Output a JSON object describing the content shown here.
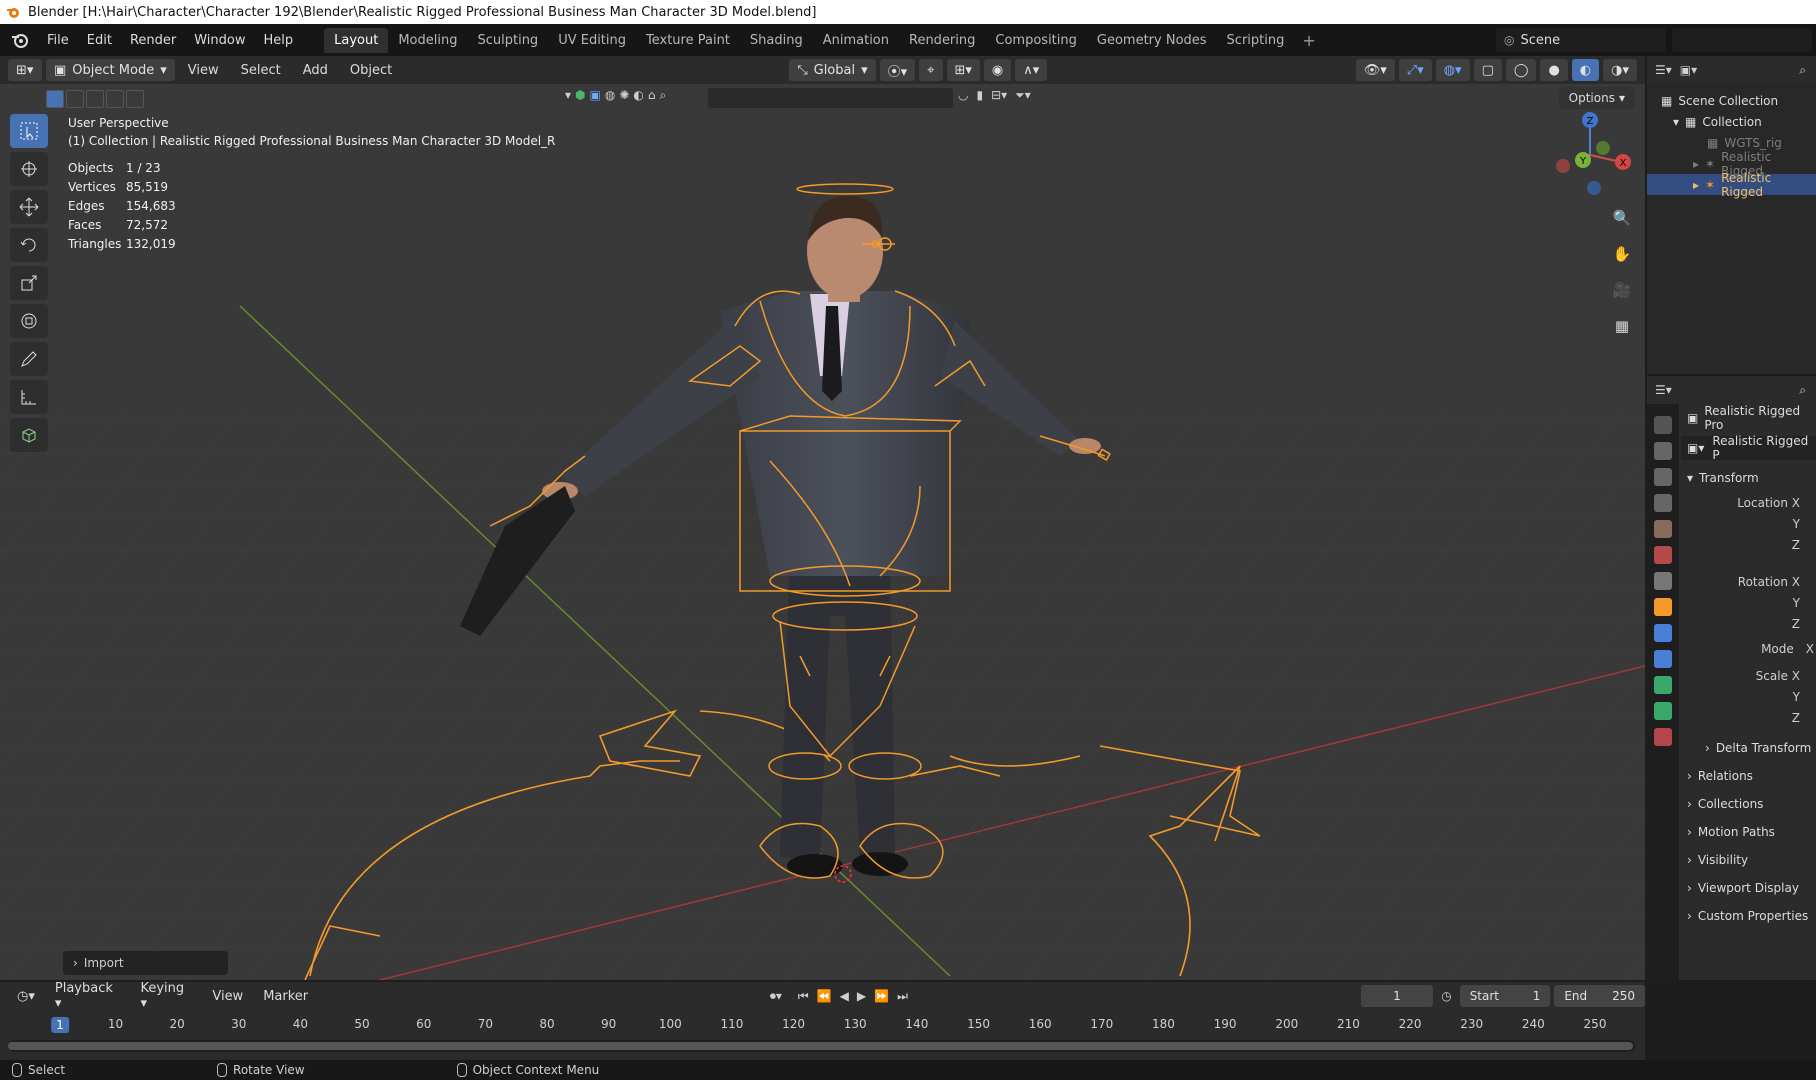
{
  "window": {
    "title": "Blender [H:\\Hair\\Character\\Character 192\\Blender\\Realistic Rigged Professional Business Man Character 3D Model.blend]"
  },
  "menu": {
    "items": [
      "File",
      "Edit",
      "Render",
      "Window",
      "Help"
    ]
  },
  "workspaces": {
    "items": [
      "Layout",
      "Modeling",
      "Sculpting",
      "UV Editing",
      "Texture Paint",
      "Shading",
      "Animation",
      "Rendering",
      "Compositing",
      "Geometry Nodes",
      "Scripting"
    ],
    "active": "Layout"
  },
  "scene": {
    "name": "Scene"
  },
  "viewport": {
    "mode": "Object Mode",
    "menus": [
      "View",
      "Select",
      "Add",
      "Object"
    ],
    "transform_orientation": "Global",
    "options_label": "Options",
    "perspective": "User Perspective",
    "collection_line": "(1) Collection | Realistic Rigged Professional Business Man Character 3D Model_R",
    "stats": [
      {
        "k": "Objects",
        "v": "1 / 23"
      },
      {
        "k": "Vertices",
        "v": "85,519"
      },
      {
        "k": "Edges",
        "v": "154,683"
      },
      {
        "k": "Faces",
        "v": "72,572"
      },
      {
        "k": "Triangles",
        "v": "132,019"
      }
    ],
    "import_label": "Import",
    "gizmo": {
      "x": "X",
      "y": "Y",
      "z": "Z"
    }
  },
  "outliner": {
    "rows": [
      {
        "label": "Scene Collection",
        "state": "normal"
      },
      {
        "label": "Collection",
        "state": "normal"
      },
      {
        "label": "WGTS_rig",
        "state": "dim"
      },
      {
        "label": "Realistic Rigged",
        "state": "dim"
      },
      {
        "label": "Realistic Rigged",
        "state": "selected"
      }
    ]
  },
  "properties": {
    "object_name": "Realistic Rigged Pro",
    "data_name": "Realistic Rigged P",
    "transform_label": "Transform",
    "fields": [
      "Location X",
      "Y",
      "Z",
      "Rotation X",
      "Y",
      "Z",
      "Mode",
      "Scale X",
      "Y",
      "Z"
    ],
    "mode_value": "X",
    "sections": [
      "Delta Transform",
      "Relations",
      "Collections",
      "Motion Paths",
      "Visibility",
      "Viewport Display",
      "Custom Properties"
    ]
  },
  "timeline": {
    "menus": [
      "Playback",
      "Keying",
      "View",
      "Marker"
    ],
    "current_frame": "1",
    "start_label": "Start",
    "start": "1",
    "end_label": "End",
    "end": "250",
    "ticks": [
      "1",
      "10",
      "20",
      "30",
      "40",
      "50",
      "60",
      "70",
      "80",
      "90",
      "100",
      "110",
      "120",
      "130",
      "140",
      "150",
      "160",
      "170",
      "180",
      "190",
      "200",
      "210",
      "220",
      "230",
      "240",
      "250"
    ]
  },
  "status": {
    "items": [
      "Select",
      "Rotate View",
      "Object Context Menu"
    ]
  }
}
